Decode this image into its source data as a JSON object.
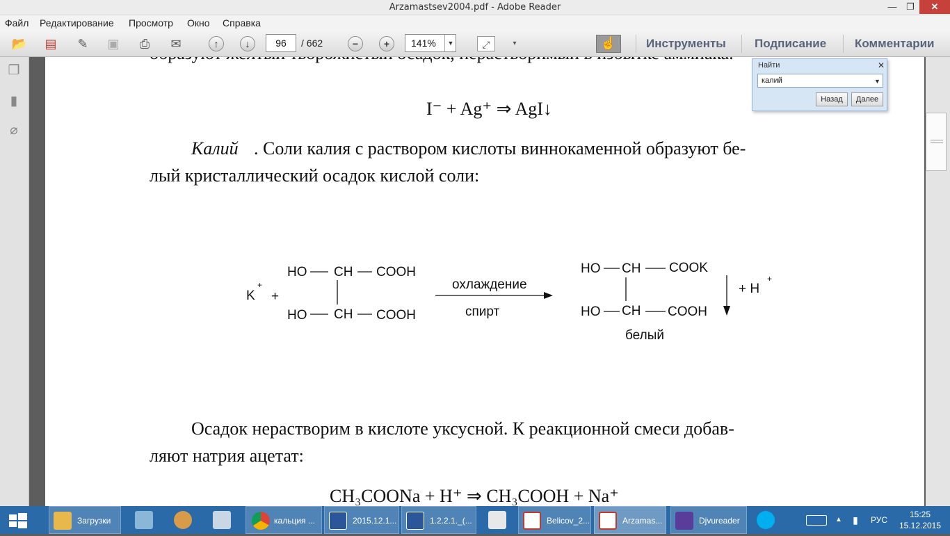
{
  "window": {
    "title": "Arzamastsev2004.pdf - Adobe Reader",
    "minimize": "—",
    "maximize": "❐",
    "close": "✕"
  },
  "menu": [
    "Файл",
    "Редактирование",
    "Просмотр",
    "Окно",
    "Справка"
  ],
  "toolbar": {
    "page_current": "96",
    "page_total": "/ 662",
    "zoom": "141%",
    "tools": "Инструменты",
    "sign": "Подписание",
    "comments": "Комментарии"
  },
  "find": {
    "title": "Найти",
    "close": "✕",
    "query": "калий",
    "back": "Назад",
    "next": "Далее"
  },
  "document": {
    "top_partial": "образуют желтый творожистый осадок, нерастворимый в избытке аммиака.",
    "eq1": "I⁻ + Ag⁺ ⇒ AgI↓",
    "para1_italic": "Калий",
    "para1_rest": ". Соли калия с раствором кислоты виннокаменной образуют бе-",
    "para1_line2": "лый кристаллический осадок кислой соли:",
    "scheme": {
      "reactant_ion": "K",
      "reactant_charge": "+",
      "plus": "+",
      "ho_top": "HO",
      "ch_top": "CH",
      "cooh_top": "COOH",
      "ho_bot": "HO",
      "ch_bot": "CH",
      "cooh_bot": "COOH",
      "cond_above": "охлаждение",
      "cond_below": "спирт",
      "p_ho_top": "HO",
      "p_ch_top": "CH",
      "p_cook": "COOK",
      "p_ho_bot": "HO",
      "p_ch_bot": "CH",
      "p_cooh": "COOH",
      "product_label": "белый",
      "plus_h": "+ H",
      "h_charge": "+"
    },
    "para2_line1": "Осадок нерастворим в кислоте уксусной. К реакционной смеси добав-",
    "para2_line2": "ляют натрия ацетат:",
    "eq2": "CH₃COONa + H⁺ ⇒ CH₃COOH + Na⁺"
  },
  "taskbar": {
    "items": [
      {
        "label": "Загрузки"
      },
      {
        "label": "кальция ..."
      },
      {
        "label": "2015.12.1..."
      },
      {
        "label": "1.2.2.1._(..."
      },
      {
        "label": "Belicov_2..."
      },
      {
        "label": "Arzamas..."
      },
      {
        "label": "Djvureader"
      }
    ],
    "lang": "РУС",
    "time": "15:25",
    "date": "15.12.2015"
  },
  "colors": {
    "taskbar": "#2a6aa8",
    "close_button": "#c7413b",
    "toolbar_text": "#59647a"
  }
}
